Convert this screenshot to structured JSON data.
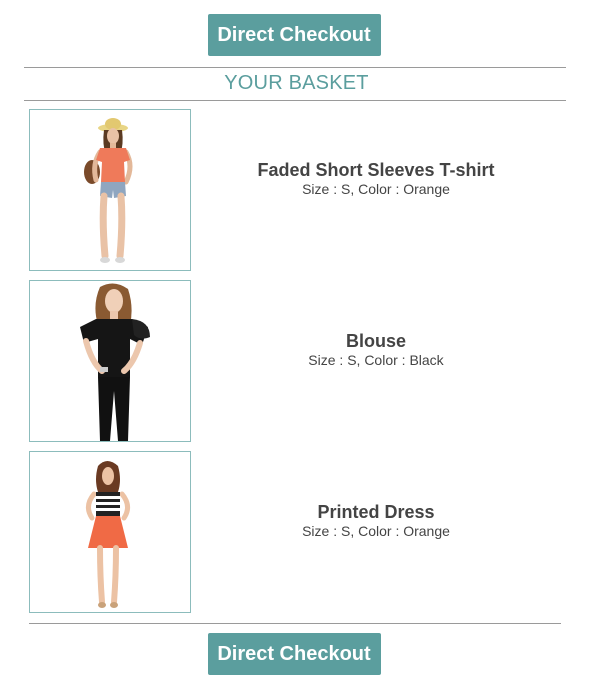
{
  "checkout": {
    "top_label": "Direct Checkout",
    "bottom_label": "Direct Checkout"
  },
  "basket": {
    "title": "YOUR BASKET",
    "items": [
      {
        "name": "Faded Short Sleeves T-shirt",
        "attributes": "Size : S, Color : Orange",
        "image": "woman-orange-tshirt-photo"
      },
      {
        "name": "Blouse",
        "attributes": "Size : S, Color : Black",
        "image": "woman-black-blouse-photo"
      },
      {
        "name": "Printed Dress",
        "attributes": "Size : S, Color : Orange",
        "image": "woman-printed-dress-photo"
      }
    ]
  },
  "colors": {
    "accent": "#5b9e9e",
    "button_text": "#ffffff",
    "thumb_border": "#8cbcbc",
    "divider": "#9a9a9a",
    "text": "#444444"
  }
}
